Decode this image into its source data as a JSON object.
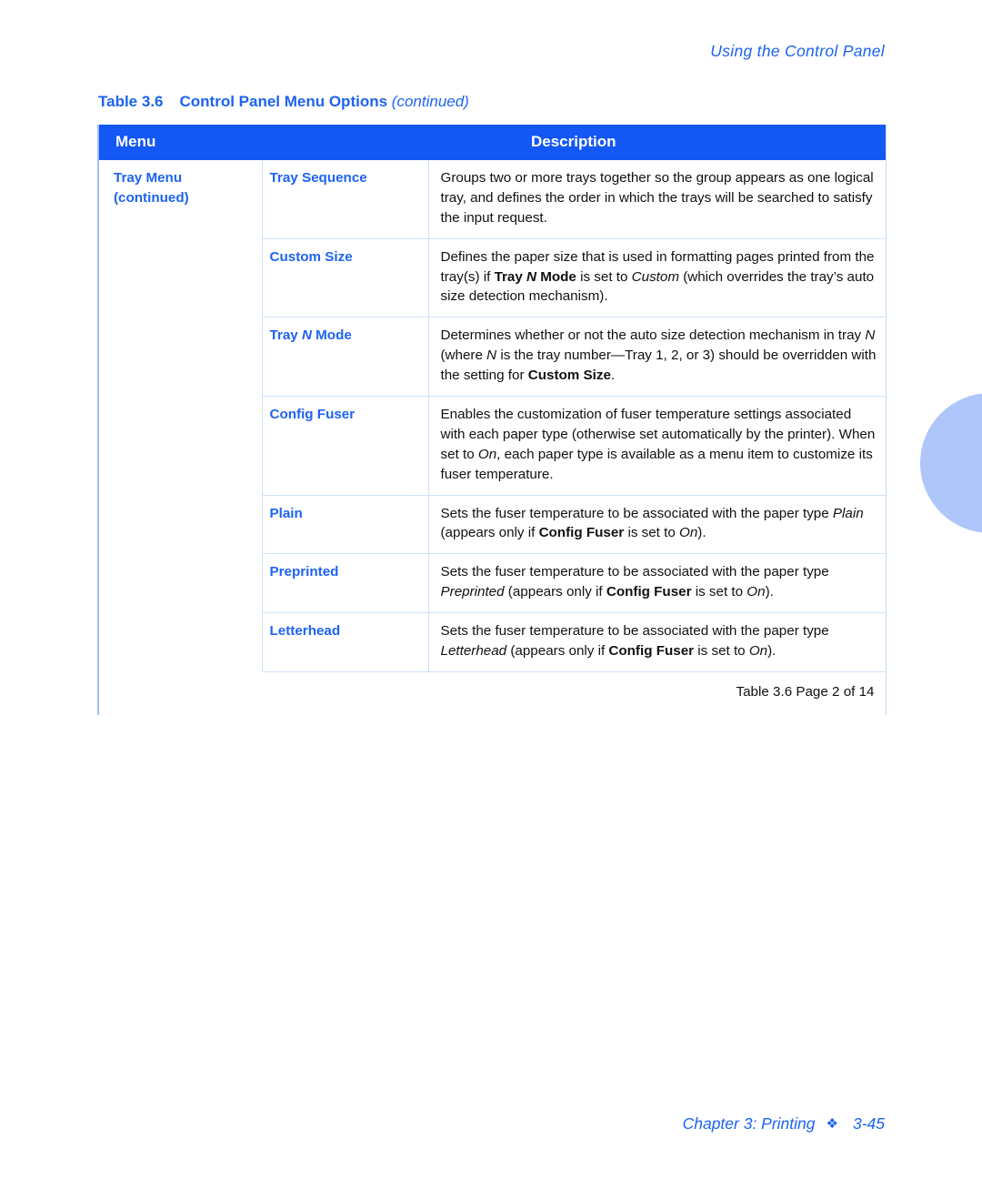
{
  "page": {
    "running_head": "Using the Control Panel",
    "footer_chapter": "Chapter 3: Printing",
    "footer_separator": "❖",
    "footer_page": "3-45",
    "thumb_tab_color": "#AEC6FA",
    "accent_color": "#1D63F2",
    "header_bar_color": "#1358F5"
  },
  "table": {
    "number_label": "Table 3.6",
    "title": "Control Panel Menu Options",
    "continued_label": "(continued)",
    "columns": [
      "Menu",
      "Description"
    ],
    "caption": "Table 3.6  Page 2 of 14",
    "menu_group": {
      "name": "Tray Menu",
      "continued": "(continued)"
    },
    "rows": [
      {
        "option": "Tray Sequence",
        "option_plain": "Tray Sequence",
        "description": "Groups two or more trays together so the group appears as one logical tray, and defines the order in which the trays will be searched to satisfy the input request."
      },
      {
        "option": "Custom Size",
        "option_plain": "Custom Size",
        "description": "Defines the paper size that is used in formatting pages printed from the tray(s) if Tray N Mode is set to Custom (which overrides the tray’s auto size detection mechanism)."
      },
      {
        "option": "Tray N Mode",
        "option_plain": "Tray N Mode",
        "description": "Determines whether or not the auto size detection mechanism in tray N (where N is the tray number—Tray 1, 2, or 3) should be overridden with the setting for Custom Size."
      },
      {
        "option": "Config Fuser",
        "option_plain": "Config Fuser",
        "description": "Enables the customization of fuser temperature settings associated with each paper type (otherwise set automatically by the printer). When set to On, each paper type is available as a menu item to customize its fuser temperature."
      },
      {
        "option": "Plain",
        "option_plain": "Plain",
        "description": "Sets the fuser temperature to be associated with the paper type Plain (appears only if Config Fuser is set to On)."
      },
      {
        "option": "Preprinted",
        "option_plain": "Preprinted",
        "description": "Sets the fuser temperature to be associated with the paper type Preprinted (appears only if Config Fuser is set to On)."
      },
      {
        "option": "Letterhead",
        "option_plain": "Letterhead",
        "description": "Sets the fuser temperature to be associated with the paper type Letterhead (appears only if Config Fuser is set to On)."
      }
    ],
    "rich_fragments": {
      "tray_sequence_desc": [
        {
          "t": "Groups two or more trays together so the group appears as one logical tray, and defines the order in which the trays will be searched to satisfy the input request."
        }
      ],
      "custom_size_desc": [
        {
          "t": "Defines the paper size that is used in formatting pages printed from the tray(s) if "
        },
        {
          "t": "Tray ",
          "b": true
        },
        {
          "t": "N",
          "b": true,
          "i": true
        },
        {
          "t": " Mode",
          "b": true
        },
        {
          "t": " is set to "
        },
        {
          "t": "Custom",
          "i": true
        },
        {
          "t": " (which overrides the tray’s auto size detection mechanism)."
        }
      ],
      "tray_n_mode_desc": [
        {
          "t": "Determines whether or not the auto size detection mechanism in tray "
        },
        {
          "t": "N",
          "i": true
        },
        {
          "t": " (where "
        },
        {
          "t": "N",
          "i": true
        },
        {
          "t": " is the tray number—Tray 1, 2, or 3) should be overridden with the setting for "
        },
        {
          "t": "Custom Size",
          "b": true
        },
        {
          "t": "."
        }
      ],
      "config_fuser_desc": [
        {
          "t": "Enables the customization of fuser temperature settings associated with each paper type (otherwise set automatically by the printer). When set to "
        },
        {
          "t": "On",
          "i": true
        },
        {
          "t": ", each paper type is available as a menu item to customize its fuser temperature."
        }
      ],
      "plain_desc": [
        {
          "t": "Sets the fuser temperature to be associated with the paper type "
        },
        {
          "t": "Plain",
          "i": true
        },
        {
          "t": " (appears only if "
        },
        {
          "t": "Config Fuser",
          "b": true
        },
        {
          "t": " is set to "
        },
        {
          "t": "On",
          "i": true
        },
        {
          "t": ")."
        }
      ],
      "preprinted_desc": [
        {
          "t": "Sets the fuser temperature to be associated with the paper type "
        },
        {
          "t": "Preprinted",
          "i": true
        },
        {
          "t": " (appears only if "
        },
        {
          "t": "Config Fuser",
          "b": true
        },
        {
          "t": " is set to "
        },
        {
          "t": "On",
          "i": true
        },
        {
          "t": ")."
        }
      ],
      "letterhead_desc": [
        {
          "t": "Sets the fuser temperature to be associated with the paper type "
        },
        {
          "t": "Letterhead",
          "i": true
        },
        {
          "t": " (appears only if "
        },
        {
          "t": "Config Fuser",
          "b": true
        },
        {
          "t": " is set to "
        },
        {
          "t": "On",
          "i": true
        },
        {
          "t": ")."
        }
      ],
      "tray_n_mode_label": [
        {
          "t": "Tray "
        },
        {
          "t": "N",
          "i": true
        },
        {
          "t": " Mode"
        }
      ]
    }
  }
}
